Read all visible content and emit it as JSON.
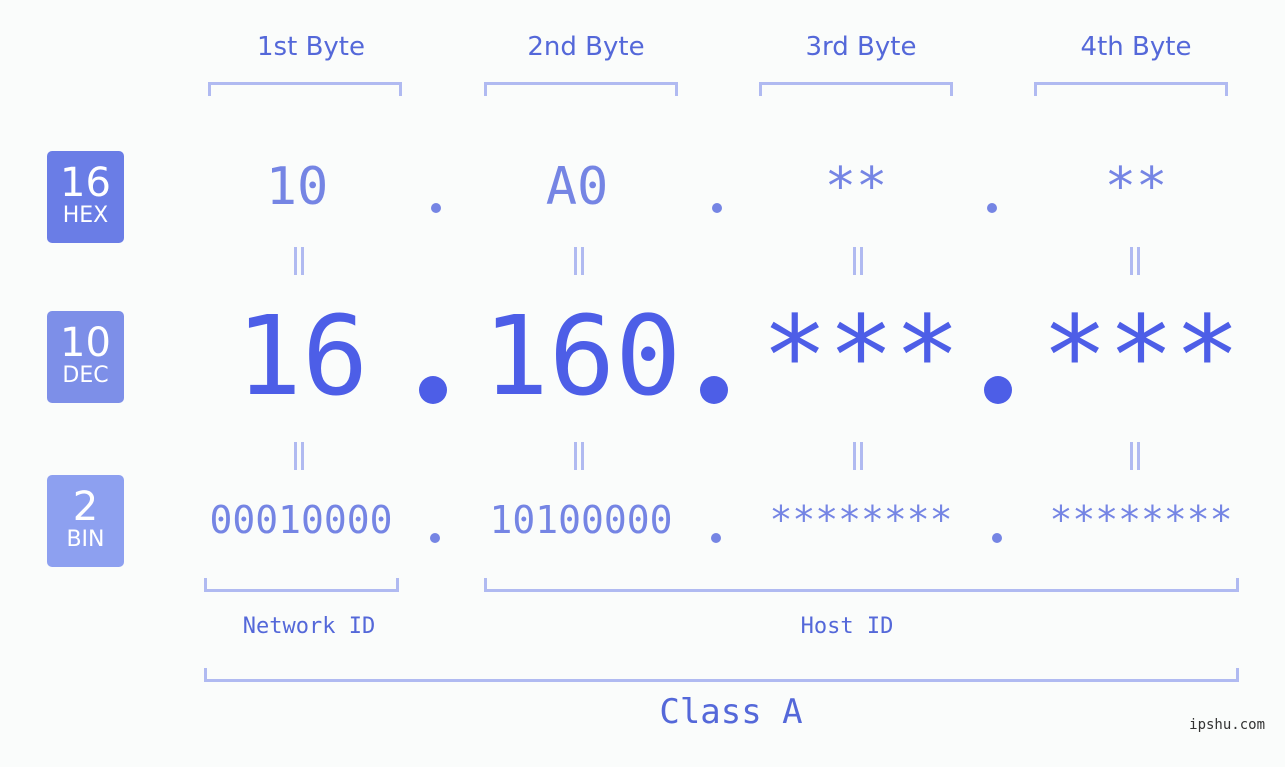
{
  "byte_headers": [
    "1st Byte",
    "2nd Byte",
    "3rd Byte",
    "4th Byte"
  ],
  "badges": [
    {
      "num": "16",
      "label": "HEX",
      "color": "#6a7de6"
    },
    {
      "num": "10",
      "label": "DEC",
      "color": "#7d8fe8"
    },
    {
      "num": "2",
      "label": "BIN",
      "color": "#8da0f0"
    }
  ],
  "hex": [
    "10",
    "A0",
    "**",
    "**"
  ],
  "dec": [
    "16",
    "160",
    "***",
    "***"
  ],
  "bin": [
    "00010000",
    "10100000",
    "********",
    "********"
  ],
  "network_id_label": "Network ID",
  "host_id_label": "Host ID",
  "class_label": "Class A",
  "watermark": "ipshu.com"
}
